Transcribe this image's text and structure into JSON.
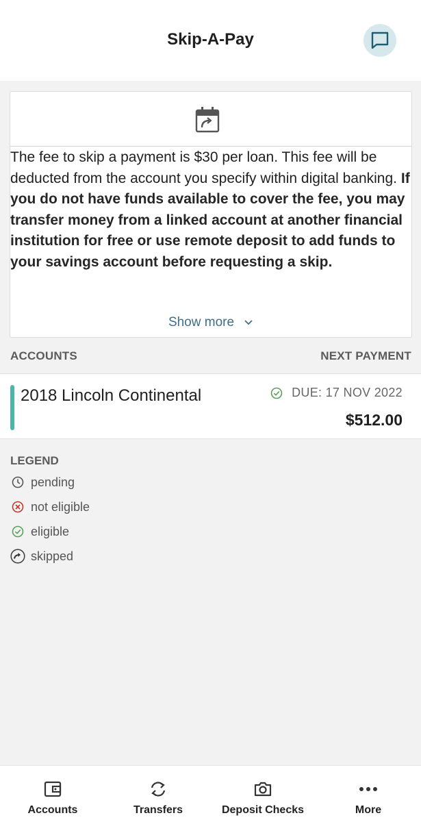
{
  "header": {
    "title": "Skip-A-Pay",
    "chat_icon": "chat-icon"
  },
  "info_card": {
    "icon": "calendar-skip-icon",
    "text_regular": "The fee to skip a payment is $30 per loan. This fee will be deducted from the account you specify within digital banking.",
    "text_bold": "If you do not have funds available to cover the fee, you may transfer money from a linked account at another financial institution for free or use remote deposit to add funds to your savings account before requesting a skip.",
    "show_more_label": "Show more"
  },
  "columns": {
    "accounts": "ACCOUNTS",
    "next_payment": "NEXT PAYMENT"
  },
  "accounts": [
    {
      "name": "2018 Lincoln Continental",
      "status": "eligible",
      "due": "DUE: 17 NOV 2022",
      "amount": "$512.00"
    }
  ],
  "legend": {
    "title": "LEGEND",
    "items": [
      {
        "label": "pending",
        "icon": "clock-icon"
      },
      {
        "label": "not eligible",
        "icon": "x-circle-icon"
      },
      {
        "label": "eligible",
        "icon": "check-circle-icon"
      },
      {
        "label": "skipped",
        "icon": "arrow-circle-icon"
      }
    ]
  },
  "colors": {
    "accent": "#4cb6a6",
    "link": "#3f6e86",
    "eligible": "#5aa05a",
    "not_eligible": "#c0392b"
  },
  "bottom_nav": [
    {
      "label": "Accounts",
      "icon": "wallet-icon"
    },
    {
      "label": "Transfers",
      "icon": "transfer-icon"
    },
    {
      "label": "Deposit Checks",
      "icon": "camera-icon"
    },
    {
      "label": "More",
      "icon": "more-dots-icon"
    }
  ]
}
